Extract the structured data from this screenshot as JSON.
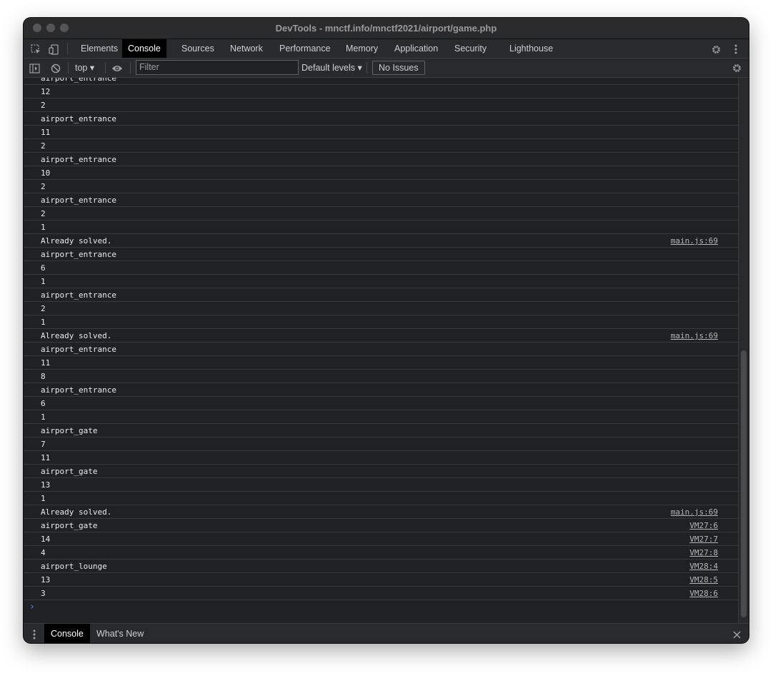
{
  "window": {
    "title": "DevTools - mnctf.info/mnctf2021/airport/game.php"
  },
  "tabs": [
    "Elements",
    "Console",
    "Sources",
    "Network",
    "Performance",
    "Memory",
    "Application",
    "Security",
    "Lighthouse"
  ],
  "active_tab": "Console",
  "toolbar": {
    "context": "top ▾",
    "filter_placeholder": "Filter",
    "levels_label": "Default levels ▾",
    "issues_label": "No Issues"
  },
  "console_rows": [
    {
      "text": "airport_entrance",
      "source": ""
    },
    {
      "text": "12",
      "source": ""
    },
    {
      "text": "2",
      "source": ""
    },
    {
      "text": "airport_entrance",
      "source": ""
    },
    {
      "text": "11",
      "source": ""
    },
    {
      "text": "2",
      "source": ""
    },
    {
      "text": "airport_entrance",
      "source": ""
    },
    {
      "text": "10",
      "source": ""
    },
    {
      "text": "2",
      "source": ""
    },
    {
      "text": "airport_entrance",
      "source": ""
    },
    {
      "text": "2",
      "source": ""
    },
    {
      "text": "1",
      "source": ""
    },
    {
      "text": "Already solved.",
      "source": "main.js:69"
    },
    {
      "text": "airport_entrance",
      "source": ""
    },
    {
      "text": "6",
      "source": ""
    },
    {
      "text": "1",
      "source": ""
    },
    {
      "text": "airport_entrance",
      "source": ""
    },
    {
      "text": "2",
      "source": ""
    },
    {
      "text": "1",
      "source": ""
    },
    {
      "text": "Already solved.",
      "source": "main.js:69"
    },
    {
      "text": "airport_entrance",
      "source": ""
    },
    {
      "text": "11",
      "source": ""
    },
    {
      "text": "8",
      "source": ""
    },
    {
      "text": "airport_entrance",
      "source": ""
    },
    {
      "text": "6",
      "source": ""
    },
    {
      "text": "1",
      "source": ""
    },
    {
      "text": "airport_gate",
      "source": ""
    },
    {
      "text": "7",
      "source": ""
    },
    {
      "text": "11",
      "source": ""
    },
    {
      "text": "airport_gate",
      "source": ""
    },
    {
      "text": "13",
      "source": ""
    },
    {
      "text": "1",
      "source": ""
    },
    {
      "text": "Already solved.",
      "source": "main.js:69"
    },
    {
      "text": "airport_gate",
      "source": "VM27:6"
    },
    {
      "text": "14",
      "source": "VM27:7"
    },
    {
      "text": "4",
      "source": "VM27:8"
    },
    {
      "text": "airport_lounge",
      "source": "VM28:4"
    },
    {
      "text": "13",
      "source": "VM28:5"
    },
    {
      "text": "3",
      "source": "VM28:6"
    }
  ],
  "prompt_glyph": "›",
  "drawer": {
    "tabs": [
      "Console",
      "What's New"
    ]
  },
  "icons": [
    "inspect-icon",
    "device-toggle-icon",
    "settings-icon",
    "more-icon",
    "sidebar-toggle-icon",
    "clear-console-icon",
    "eye-icon",
    "console-settings-icon",
    "drawer-menu-icon",
    "close-icon"
  ]
}
